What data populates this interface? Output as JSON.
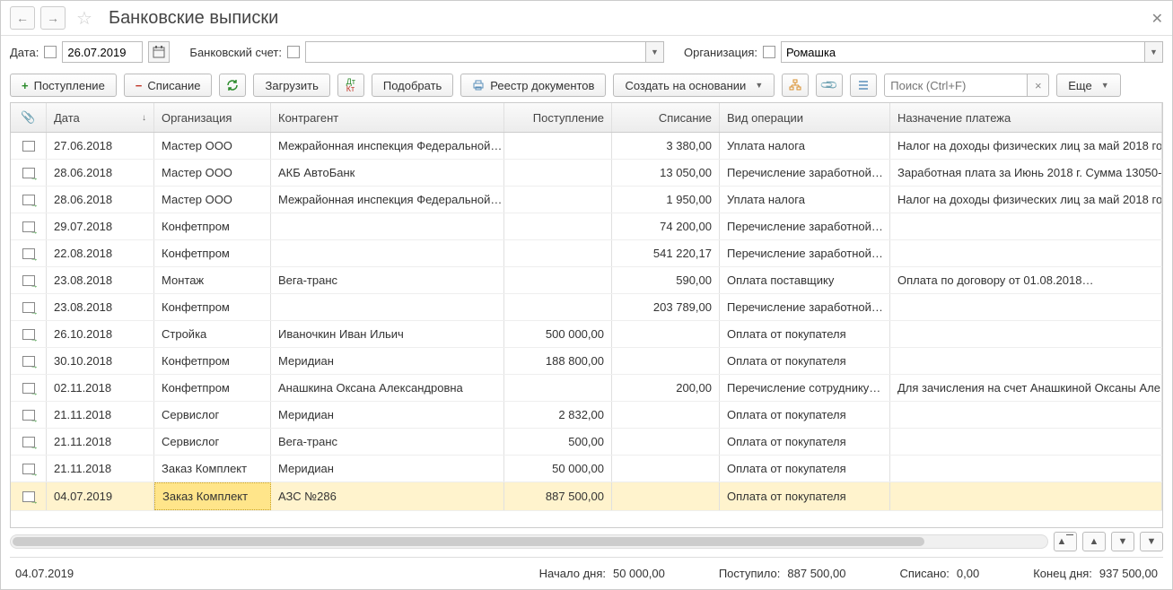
{
  "title": "Банковские выписки",
  "filters": {
    "date_label": "Дата:",
    "date_value": "26.07.2019",
    "account_label": "Банковский счет:",
    "account_value": "",
    "org_label": "Организация:",
    "org_value": "Ромашка"
  },
  "toolbar": {
    "incoming": "Поступление",
    "outgoing": "Списание",
    "load": "Загрузить",
    "pick": "Подобрать",
    "registry": "Реестр документов",
    "create_based": "Создать на основании",
    "more": "Еще",
    "search_placeholder": "Поиск (Ctrl+F)"
  },
  "columns": {
    "date": "Дата",
    "org": "Организация",
    "agent": "Контрагент",
    "in": "Поступление",
    "out": "Списание",
    "op": "Вид операции",
    "desc": "Назначение платежа"
  },
  "rows": [
    {
      "ico": "doc",
      "date": "27.06.2018",
      "org": "Мастер ООО",
      "agent": "Межрайонная инспекция Федеральной…",
      "in": "",
      "out": "3 380,00",
      "op": "Уплата налога",
      "desc": "Налог на доходы физических лиц за май 2018 го.",
      "sel": false
    },
    {
      "ico": "arr",
      "date": "28.06.2018",
      "org": "Мастер ООО",
      "agent": "АКБ АвтоБанк",
      "in": "",
      "out": "13 050,00",
      "op": "Перечисление заработной…",
      "desc": "Заработная плата за Июнь 2018 г. Сумма 13050-.",
      "sel": false
    },
    {
      "ico": "arr",
      "date": "28.06.2018",
      "org": "Мастер ООО",
      "agent": "Межрайонная инспекция Федеральной…",
      "in": "",
      "out": "1 950,00",
      "op": "Уплата налога",
      "desc": "Налог на доходы физических лиц за май 2018 го.",
      "sel": false
    },
    {
      "ico": "arr",
      "date": "29.07.2018",
      "org": "Конфетпром",
      "agent": "",
      "in": "",
      "out": "74 200,00",
      "op": "Перечисление заработной…",
      "desc": "",
      "sel": false
    },
    {
      "ico": "arr",
      "date": "22.08.2018",
      "org": "Конфетпром",
      "agent": "",
      "in": "",
      "out": "541 220,17",
      "op": "Перечисление заработной…",
      "desc": "",
      "sel": false
    },
    {
      "ico": "arr",
      "date": "23.08.2018",
      "org": "Монтаж",
      "agent": "Вега-транс",
      "in": "",
      "out": "590,00",
      "op": "Оплата поставщику",
      "desc": "Оплата по договору от 01.08.2018…",
      "sel": false
    },
    {
      "ico": "arr",
      "date": "23.08.2018",
      "org": "Конфетпром",
      "agent": "",
      "in": "",
      "out": "203 789,00",
      "op": "Перечисление заработной…",
      "desc": "",
      "sel": false
    },
    {
      "ico": "arr",
      "date": "26.10.2018",
      "org": "Стройка",
      "agent": "Иваночкин Иван Ильич",
      "in": "500 000,00",
      "out": "",
      "op": "Оплата от покупателя",
      "desc": "",
      "sel": false
    },
    {
      "ico": "arr",
      "date": "30.10.2018",
      "org": "Конфетпром",
      "agent": "Меридиан",
      "in": "188 800,00",
      "out": "",
      "op": "Оплата от покупателя",
      "desc": "",
      "sel": false
    },
    {
      "ico": "arr",
      "date": "02.11.2018",
      "org": "Конфетпром",
      "agent": "Анашкина Оксана Александровна",
      "in": "",
      "out": "200,00",
      "op": "Перечисление сотруднику…",
      "desc": "Для зачисления на счет Анашкиной Оксаны Але.",
      "sel": false
    },
    {
      "ico": "arr",
      "date": "21.11.2018",
      "org": "Сервислог",
      "agent": "Меридиан",
      "in": "2 832,00",
      "out": "",
      "op": "Оплата от покупателя",
      "desc": "",
      "sel": false
    },
    {
      "ico": "arr",
      "date": "21.11.2018",
      "org": "Сервислог",
      "agent": "Вега-транс",
      "in": "500,00",
      "out": "",
      "op": "Оплата от покупателя",
      "desc": "",
      "sel": false
    },
    {
      "ico": "arr",
      "date": "21.11.2018",
      "org": "Заказ Комплект",
      "agent": "Меридиан",
      "in": "50 000,00",
      "out": "",
      "op": "Оплата от покупателя",
      "desc": "",
      "sel": false
    },
    {
      "ico": "arr",
      "date": "04.07.2019",
      "org": "Заказ Комплект",
      "agent": "АЗС №286",
      "in": "887 500,00",
      "out": "",
      "op": "Оплата от покупателя",
      "desc": "",
      "sel": true
    }
  ],
  "status": {
    "date": "04.07.2019",
    "begin_label": "Начало дня:",
    "begin_value": "50 000,00",
    "in_label": "Поступило:",
    "in_value": "887 500,00",
    "out_label": "Списано:",
    "out_value": "0,00",
    "end_label": "Конец дня:",
    "end_value": "937 500,00"
  }
}
